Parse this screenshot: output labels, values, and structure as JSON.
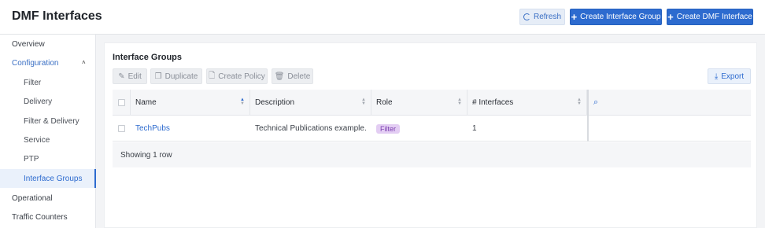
{
  "header": {
    "title": "DMF Interfaces",
    "refresh_label": "Refresh",
    "create_group_label": "Create Interface Group",
    "create_interface_label": "Create DMF Interface"
  },
  "sidebar": {
    "items": [
      {
        "label": "Overview"
      },
      {
        "label": "Configuration"
      },
      {
        "label": "Filter"
      },
      {
        "label": "Delivery"
      },
      {
        "label": "Filter & Delivery"
      },
      {
        "label": "Service"
      },
      {
        "label": "PTP"
      },
      {
        "label": "Interface Groups"
      },
      {
        "label": "Operational"
      },
      {
        "label": "Traffic Counters"
      }
    ]
  },
  "panel": {
    "title": "Interface Groups",
    "toolbar": {
      "edit": "Edit",
      "duplicate": "Duplicate",
      "create_policy": "Create Policy",
      "delete": "Delete",
      "export": "Export"
    }
  },
  "table": {
    "columns": [
      "Name",
      "Description",
      "Role",
      "# Interfaces"
    ],
    "rows": [
      {
        "name": "TechPubs",
        "description": "Technical Publications example.",
        "role": "Filter",
        "interfaces": "1"
      }
    ],
    "footer": "Showing 1 row"
  },
  "colors": {
    "accent": "#2d6bcf",
    "role_badge_bg": "#e3cdf3",
    "role_badge_text": "#7c3fb0"
  }
}
